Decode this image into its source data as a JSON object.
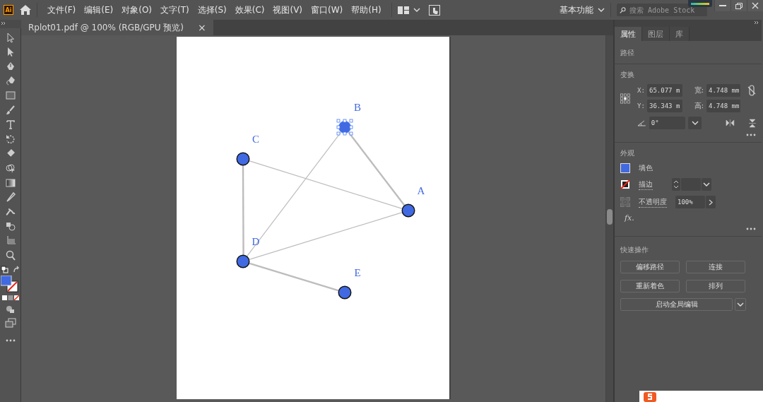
{
  "menubar": {
    "logo": "Ai",
    "menus": [
      "文件(F)",
      "编辑(E)",
      "对象(O)",
      "文字(T)",
      "选择(S)",
      "效果(C)",
      "视图(V)",
      "窗口(W)",
      "帮助(H)"
    ],
    "workspace": "基本功能",
    "search": {
      "placeholder": "搜索 Adobe Stock"
    }
  },
  "document_tab": {
    "title": "Rplot01.pdf @ 100% (RGB/GPU 预览)",
    "close": "×"
  },
  "graph": {
    "nodes": [
      {
        "label": "A",
        "selected": false
      },
      {
        "label": "B",
        "selected": true
      },
      {
        "label": "C",
        "selected": false
      },
      {
        "label": "D",
        "selected": false
      },
      {
        "label": "E",
        "selected": false
      }
    ],
    "edges": [
      {
        "thick": true
      },
      {
        "thick": false
      },
      {
        "thick": false
      },
      {
        "thick": false
      },
      {
        "thick": true
      },
      {
        "thick": true
      }
    ]
  },
  "panel": {
    "tabs": [
      {
        "label": "属性",
        "selected": true
      },
      {
        "label": "图层",
        "selected": false
      },
      {
        "label": "库",
        "selected": false
      }
    ],
    "object_type": "路径",
    "transform": {
      "title": "变换",
      "x_label": "X:",
      "x": "65.077 m",
      "w_label": "宽:",
      "w": "4.748 mm",
      "y_label": "Y:",
      "y": "36.343 m",
      "h_label": "高:",
      "h": "4.748 mm",
      "angle": "0°"
    },
    "appearance": {
      "title": "外观",
      "fill_label": "填色",
      "stroke_label": "描边",
      "opacity_label": "不透明度",
      "opacity": "100%",
      "fx": "fx."
    },
    "quick_actions": {
      "title": "快速操作",
      "buttons": [
        "偏移路径",
        "连接",
        "重新着色",
        "排列"
      ],
      "global_edit": "启动全局编辑"
    }
  }
}
